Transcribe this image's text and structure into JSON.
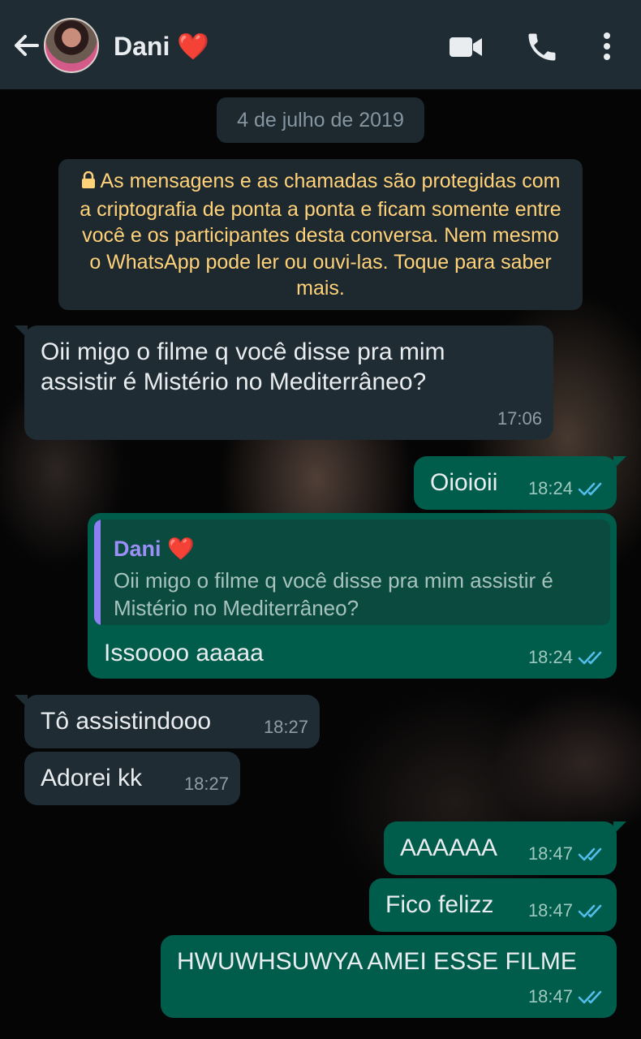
{
  "header": {
    "contact_name": "Dani",
    "heart": "❤️",
    "icons": [
      "back-arrow-icon",
      "video-call-icon",
      "phone-icon",
      "more-options-icon"
    ]
  },
  "chat": {
    "date_label": "4 de julho de 2019",
    "encryption_notice": "As mensagens e as chamadas são protegidas com a criptografia de ponta a ponta e ficam somente entre você e os participantes desta conversa. Nem mesmo o WhatsApp pode ler ou ouvi-las. Toque para saber mais.",
    "messages": [
      {
        "direction": "incoming",
        "text": "Oii migo o filme q você disse pra mim assistir é Mistério no Mediterrâneo?",
        "time": "17:06"
      },
      {
        "direction": "outgoing",
        "text": "Oioioii",
        "time": "18:24",
        "status": "read"
      },
      {
        "direction": "outgoing",
        "text": "Issoooo aaaaa",
        "time": "18:24",
        "status": "read",
        "quote": {
          "name": "Dani",
          "heart": "❤️",
          "text": "Oii migo o filme q você disse pra mim assistir é Mistério no Mediterrâneo?"
        }
      },
      {
        "direction": "incoming",
        "text": "Tô assistindooo",
        "time": "18:27"
      },
      {
        "direction": "incoming",
        "text": "Adorei kk",
        "time": "18:27"
      },
      {
        "direction": "outgoing",
        "text": "AAAAAA",
        "time": "18:47",
        "status": "read"
      },
      {
        "direction": "outgoing",
        "text": "Fico felizz",
        "time": "18:47",
        "status": "read"
      },
      {
        "direction": "outgoing",
        "text": "HWUWHSUWYA AMEI ESSE FILME",
        "time": "18:47",
        "status": "read"
      }
    ]
  },
  "colors": {
    "header_bg": "#1f2c34",
    "incoming_bubble": "#1f2c34",
    "outgoing_bubble": "#005c4b",
    "notice_text": "#ffd279",
    "read_ticks": "#53bdeb",
    "quote_accent": "#8f7ff5"
  }
}
